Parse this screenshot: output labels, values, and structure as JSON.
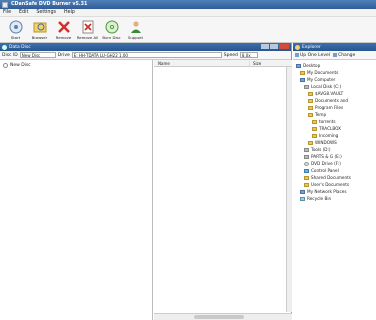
{
  "window": {
    "title": "CDanSafe DVD Burner v5.31"
  },
  "menu": [
    "File",
    "Edit",
    "Settings",
    "Help"
  ],
  "toolbar": [
    {
      "label": "Start",
      "icon": "start-icon"
    },
    {
      "label": "Browser",
      "icon": "browser-icon"
    },
    {
      "label": "Remove",
      "icon": "remove-icon"
    },
    {
      "label": "Remove All",
      "icon": "remove-all-icon"
    },
    {
      "label": "Burn Disc",
      "icon": "burn-disc-icon"
    },
    {
      "label": "Support",
      "icon": "support-icon"
    }
  ],
  "disc_panel": {
    "title": "Data Disc",
    "disc_id_label": "Disc ID",
    "disc_id_value": "New Disc",
    "drive_label": "Drive",
    "drive_value": "E: HH-TDATA LU-GH22 1.00",
    "speed_label": "Speed",
    "speed_value": "8.0x",
    "tree_root": "New Disc",
    "columns": [
      "Name",
      "Size"
    ]
  },
  "explorer": {
    "title": "Explorer",
    "btn_up": "Up One Level",
    "btn_change": "Change",
    "tree": [
      {
        "label": "Desktop",
        "icon": "desktop",
        "level": 0
      },
      {
        "label": "My Documents",
        "icon": "folder",
        "level": 1
      },
      {
        "label": "My Computer",
        "icon": "computer",
        "level": 1
      },
      {
        "label": "Local Disk (C:)",
        "icon": "drive",
        "level": 2
      },
      {
        "label": "$AVG8.VAULT",
        "icon": "folder",
        "level": 3
      },
      {
        "label": "Documents and",
        "icon": "folder",
        "level": 3
      },
      {
        "label": "Program Files",
        "icon": "folder",
        "level": 3
      },
      {
        "label": "Temp",
        "icon": "folder",
        "level": 3
      },
      {
        "label": "torrents",
        "icon": "folder",
        "level": 4
      },
      {
        "label": "TRACLBOX",
        "icon": "folder",
        "level": 4
      },
      {
        "label": "Incoming",
        "icon": "folder",
        "level": 4
      },
      {
        "label": "WINDOWS",
        "icon": "folder",
        "level": 3
      },
      {
        "label": "Tools (D:)",
        "icon": "drive",
        "level": 2
      },
      {
        "label": "PARTS & G (E:)",
        "icon": "drive",
        "level": 2
      },
      {
        "label": "DVD Drive (F:)",
        "icon": "cd",
        "level": 2
      },
      {
        "label": "Control Panel",
        "icon": "control",
        "level": 2
      },
      {
        "label": "Shared Documents",
        "icon": "folder",
        "level": 2
      },
      {
        "label": "User's Documents",
        "icon": "folder",
        "level": 2
      },
      {
        "label": "My Network Places",
        "icon": "network",
        "level": 1
      },
      {
        "label": "Recycle Bin",
        "icon": "recycle",
        "level": 1
      }
    ]
  }
}
